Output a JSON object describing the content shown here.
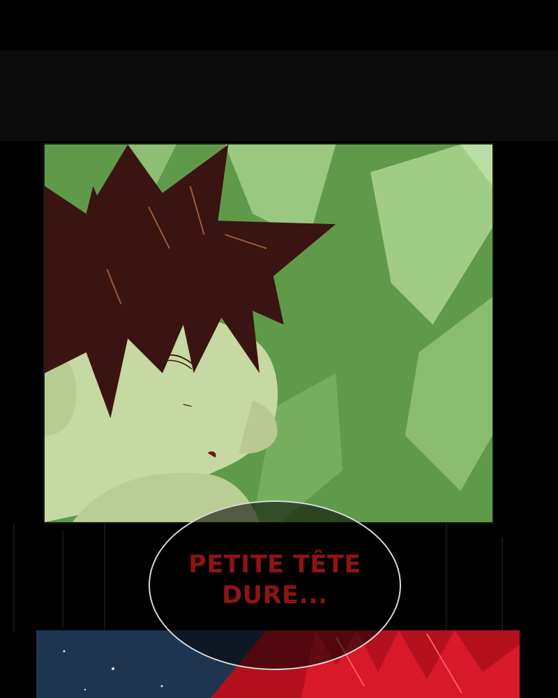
{
  "colors": {
    "background": "#000000",
    "panel_green": "#5f9a4a",
    "hair": "#3a1410",
    "bubble_text": "#8e1414",
    "bubble_border": "#d9d9d9"
  },
  "speech_bubble": {
    "line1": "PETITE TÊTE",
    "line2": "DURE..."
  }
}
